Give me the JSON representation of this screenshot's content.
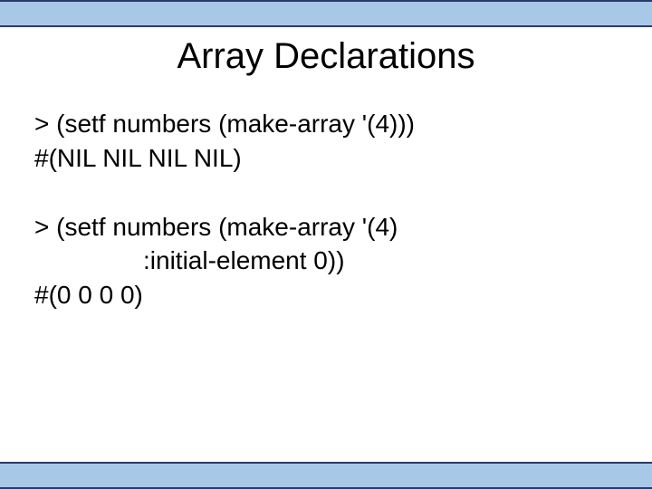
{
  "title": "Array Declarations",
  "block1": {
    "line1": "> (setf numbers (make-array '(4)))",
    "line2": "#(NIL NIL NIL NIL)"
  },
  "block2": {
    "line1": "> (setf numbers (make-array '(4)",
    "line2": ":initial-element 0))",
    "line3": "#(0 0 0 0)"
  }
}
